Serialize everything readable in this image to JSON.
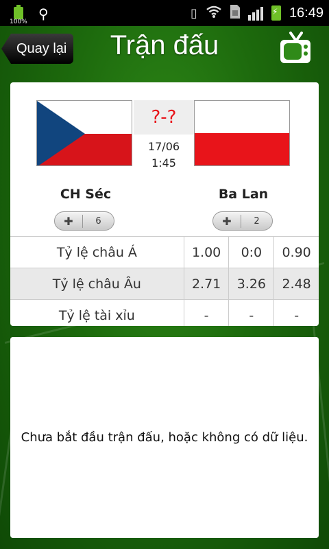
{
  "status_bar": {
    "battery_percent": "100%",
    "time": "16:49",
    "icons": [
      "battery-icon",
      "usb-icon",
      "vibrate-icon",
      "wifi-icon",
      "sim-icon",
      "signal-icon",
      "charging-battery-icon"
    ]
  },
  "header": {
    "back_label": "Quay lại",
    "title": "Trận đấu",
    "tv_icon": "tv-icon"
  },
  "match": {
    "score": "?-?",
    "date": "17/06",
    "time": "1:45",
    "home": {
      "name": "CH Séc",
      "votes": "6",
      "flag": "czech-flag"
    },
    "away": {
      "name": "Ba Lan",
      "votes": "2",
      "flag": "poland-flag"
    }
  },
  "odds": [
    {
      "label": "Tỷ lệ châu Á",
      "values": [
        "1.00",
        "0:0",
        "0.90"
      ]
    },
    {
      "label": "Tỷ lệ châu Âu",
      "values": [
        "2.71",
        "3.26",
        "2.48"
      ]
    },
    {
      "label": "Tỷ lệ tài xỉu",
      "values": [
        "-",
        "-",
        "-"
      ]
    }
  ],
  "info": {
    "message": "Chưa bắt đầu trận đấu, hoặc không có dữ liệu."
  },
  "colors": {
    "score_red": "#e8141a",
    "field_green": "#2f8a18",
    "battery_green": "#6fc028"
  }
}
